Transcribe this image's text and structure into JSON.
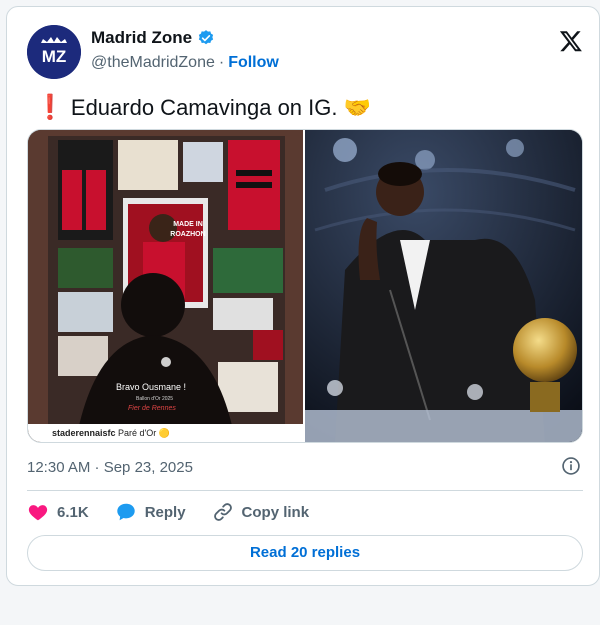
{
  "author": {
    "display_name": "Madrid Zone",
    "handle": "@theMadridZone",
    "separator": "·",
    "follow_label": "Follow",
    "avatar_text": "MZ",
    "verified_color": "#1d9bf0"
  },
  "tweet": {
    "text": "Eduardo Camavinga on IG.",
    "lead_emoji": "❗",
    "trail_emoji": "🤝"
  },
  "media": {
    "left_image": {
      "poster_headline": "MADE IN ROAZHON",
      "poster_caption": "Bravo Ousmane !",
      "poster_subcaption": "Ballon d'Or 2025",
      "poster_signature": "Fier de Rennes",
      "instagram_user": "staderennaisfc",
      "instagram_caption": "Paré d'Or 🟡"
    },
    "right_image": {
      "description_hidden": ""
    }
  },
  "timestamp": "12:30 AM · Sep 23, 2025",
  "actions": {
    "likes_count": "6.1K",
    "reply_label": "Reply",
    "copy_link_label": "Copy link"
  },
  "read_replies_label": "Read 20 replies",
  "colors": {
    "accent": "#006fd6",
    "like": "#f91880",
    "reply_icon": "#1d9bf0",
    "muted": "#536471"
  },
  "icons": [
    "verified-badge-icon",
    "x-logo-icon",
    "info-icon",
    "heart-icon",
    "reply-bubble-icon",
    "link-icon"
  ]
}
